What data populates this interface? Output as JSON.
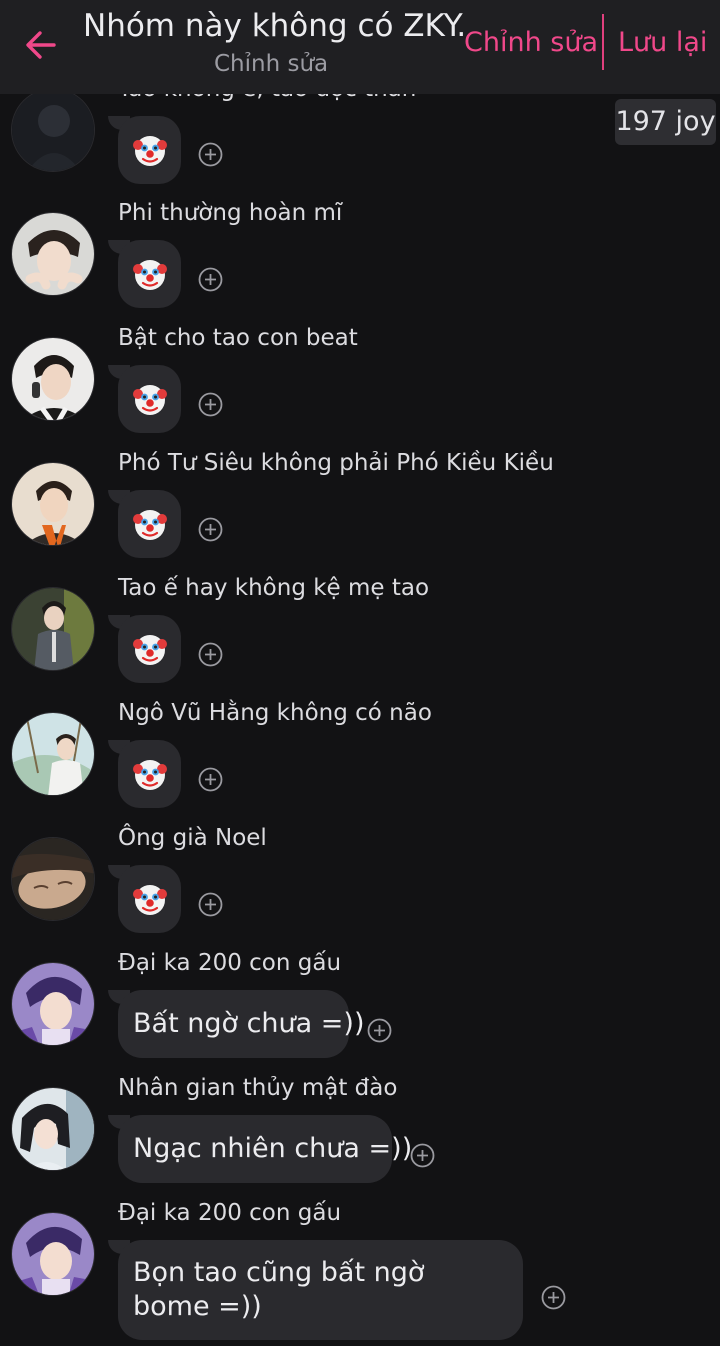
{
  "header": {
    "title": "Nhóm này không có ZKY...",
    "subtitle": "Chỉnh sửa",
    "edit_label": "Chỉnh sửa",
    "save_label": "Lưu lại"
  },
  "joy_badge": "197 joy",
  "colors": {
    "accent": "#f0488a",
    "background": "#121214",
    "header_bg": "#1f1f22",
    "bubble_bg": "#2a2a2e"
  },
  "messages": [
    {
      "sender": "Tao không ế, tao độc thân",
      "type": "emoji",
      "icon": "clown-face-icon"
    },
    {
      "sender": "Phi thường hoàn mĩ",
      "type": "emoji",
      "icon": "clown-face-icon"
    },
    {
      "sender": "Bật cho tao con beat",
      "type": "emoji",
      "icon": "clown-face-icon"
    },
    {
      "sender": "Phó Tư Siêu không phải Phó Kiều Kiều",
      "type": "emoji",
      "icon": "clown-face-icon"
    },
    {
      "sender": "Tao ế hay không kệ mẹ tao",
      "type": "emoji",
      "icon": "clown-face-icon"
    },
    {
      "sender": "Ngô Vũ Hằng không có não",
      "type": "emoji",
      "icon": "clown-face-icon"
    },
    {
      "sender": "Ông già Noel",
      "type": "emoji",
      "icon": "clown-face-icon"
    },
    {
      "sender": "Đại ka 200 con gấu",
      "type": "text",
      "text": "Bất ngờ chưa =))"
    },
    {
      "sender": "Nhân gian thủy mật đào",
      "type": "text",
      "text": "Ngạc nhiên chưa =))"
    },
    {
      "sender": "Đại ka 200 con gấu",
      "type": "text",
      "text": "Bọn tao cũng bất ngờ bome =))"
    }
  ]
}
